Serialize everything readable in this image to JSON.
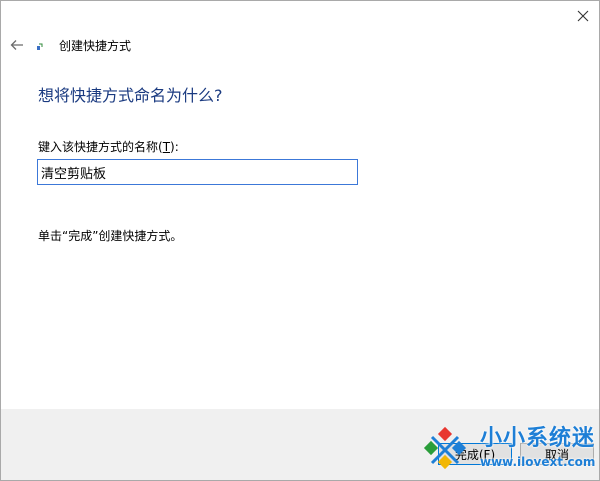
{
  "wizard": {
    "title": "创建快捷方式",
    "heading": "想将快捷方式命名为什么?",
    "field_label_prefix": "键入该快捷方式的名称(",
    "field_label_accel": "T",
    "field_label_suffix": "):",
    "name_value": "清空剪贴板",
    "hint": "单击“完成”创建快捷方式。"
  },
  "footer": {
    "finish_label": "完成(F)",
    "cancel_label": "取消"
  },
  "watermark": {
    "brand": "小小系统迷",
    "url": "www.ilovext.com"
  },
  "icons": {
    "close": "close-icon",
    "back": "back-arrow-icon",
    "wizard": "shortcut-wizard-icon"
  },
  "colors": {
    "heading": "#1a3a80",
    "input_border": "#3c78d8",
    "footer_bg": "#f0f0f0",
    "watermark": "#1e7fd6"
  }
}
